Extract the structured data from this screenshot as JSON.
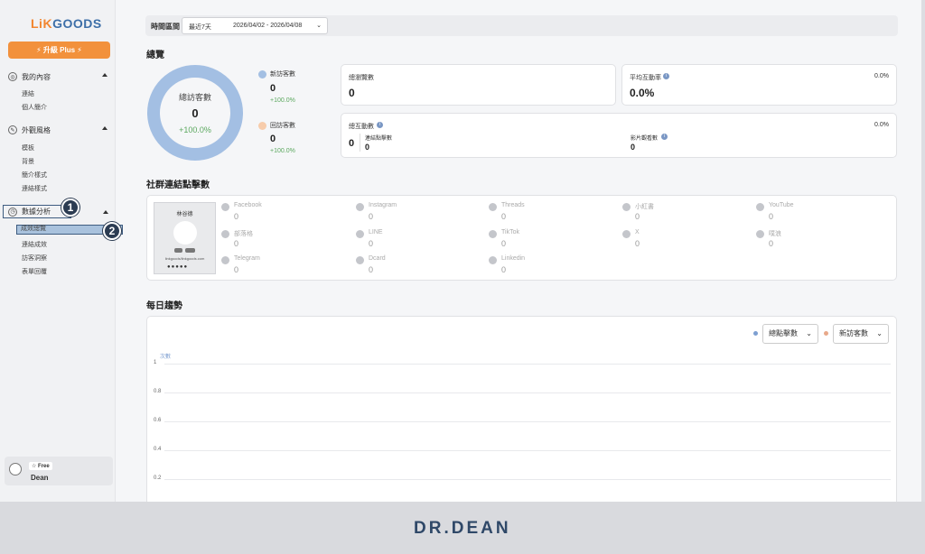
{
  "sidebar": {
    "logo_a": "LiK",
    "logo_b": "GOODS",
    "upgrade_label": "⚡ 升級 Plus ⚡",
    "sections": [
      {
        "label": "我的內容",
        "items": [
          "連結",
          "個人簡介"
        ]
      },
      {
        "label": "外觀風格",
        "items": [
          "模板",
          "背景",
          "簡介樣式",
          "連結樣式"
        ]
      },
      {
        "label": "數據分析",
        "items": [
          "成效總覽",
          "連結成效",
          "訪客洞察",
          "表單回覆"
        ]
      }
    ],
    "markers": [
      "1",
      "2"
    ],
    "user": {
      "plan": "☆ Free",
      "name": "Dean"
    }
  },
  "filter": {
    "label": "時間區間",
    "range": "最近7天",
    "dates": "2026/04/02 - 2026/04/08",
    "chevron": "⌄"
  },
  "overview": {
    "title": "總覽",
    "donut": {
      "label": "總訪客數",
      "value": "0",
      "change": "+100.0%"
    },
    "new_visitors": {
      "label": "新訪客數",
      "value": "0",
      "change": "+100.0%",
      "color": "#a3bfe3"
    },
    "return_visitors": {
      "label": "回訪客數",
      "value": "0",
      "change": "+100.0%",
      "color": "#f7ccab"
    },
    "total_views": {
      "label": "總瀏覽數",
      "value": "0"
    },
    "avg_engagement": {
      "label": "平均互動率",
      "value": "0.0%",
      "pct": "0.0%"
    },
    "total_interactions": {
      "label": "總互動數",
      "pct": "0.0%",
      "value": "0",
      "link_clicks_label": "連結點擊數",
      "link_clicks": "0",
      "video_label": "影片觀看數",
      "video": "0"
    }
  },
  "social": {
    "title": "社群連結點擊數",
    "preview": {
      "name": "林谷德",
      "url": "linkgoods/linkgoods.com"
    },
    "items": [
      {
        "name": "Facebook",
        "value": "0"
      },
      {
        "name": "Instagram",
        "value": "0"
      },
      {
        "name": "Threads",
        "value": "0"
      },
      {
        "name": "小紅書",
        "value": "0"
      },
      {
        "name": "YouTube",
        "value": "0"
      },
      {
        "name": "部落格",
        "value": "0"
      },
      {
        "name": "LINE",
        "value": "0"
      },
      {
        "name": "TikTok",
        "value": "0"
      },
      {
        "name": "X",
        "value": "0"
      },
      {
        "name": "噗浪",
        "value": "0"
      },
      {
        "name": "Telegram",
        "value": "0"
      },
      {
        "name": "Dcard",
        "value": "0"
      },
      {
        "name": "Linkedin",
        "value": "0"
      }
    ]
  },
  "trend": {
    "title": "每日趨勢",
    "metric1": "總點擊數",
    "metric1_color": "#7d9fd1",
    "metric2": "新訪客數",
    "metric2_color": "#e8a98a",
    "y_unit": "次數",
    "y_ticks": [
      "1",
      "0.8",
      "0.6",
      "0.4",
      "0.2"
    ]
  },
  "footer": {
    "brand": "DR.DEAN"
  }
}
